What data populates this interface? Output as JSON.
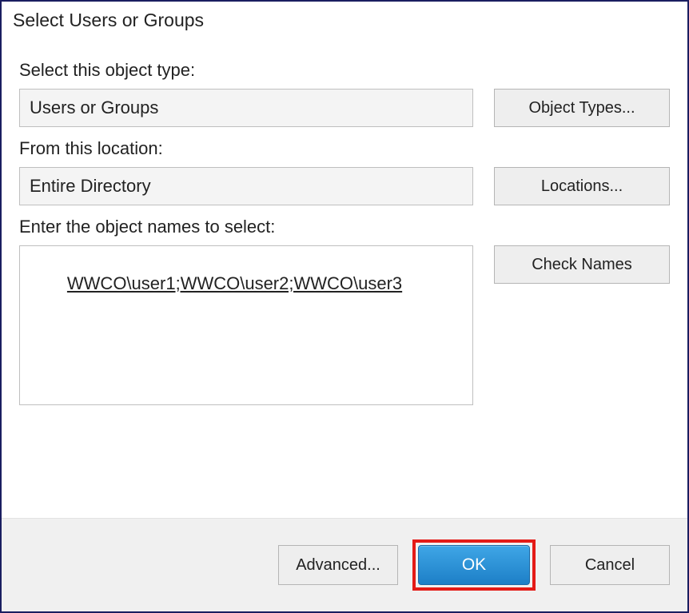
{
  "dialog": {
    "title": "Select Users or Groups",
    "objectType": {
      "label": "Select this object type:",
      "value": "Users or Groups",
      "buttonLabel": "Object Types..."
    },
    "location": {
      "label": "From this location:",
      "value": "Entire Directory",
      "buttonLabel": "Locations..."
    },
    "objectNames": {
      "label": "Enter the object names to select:",
      "value": "WWCO\\user1;WWCO\\user2;WWCO\\user3",
      "buttonLabel": "Check Names"
    },
    "buttons": {
      "advanced": "Advanced...",
      "ok": "OK",
      "cancel": "Cancel"
    }
  }
}
